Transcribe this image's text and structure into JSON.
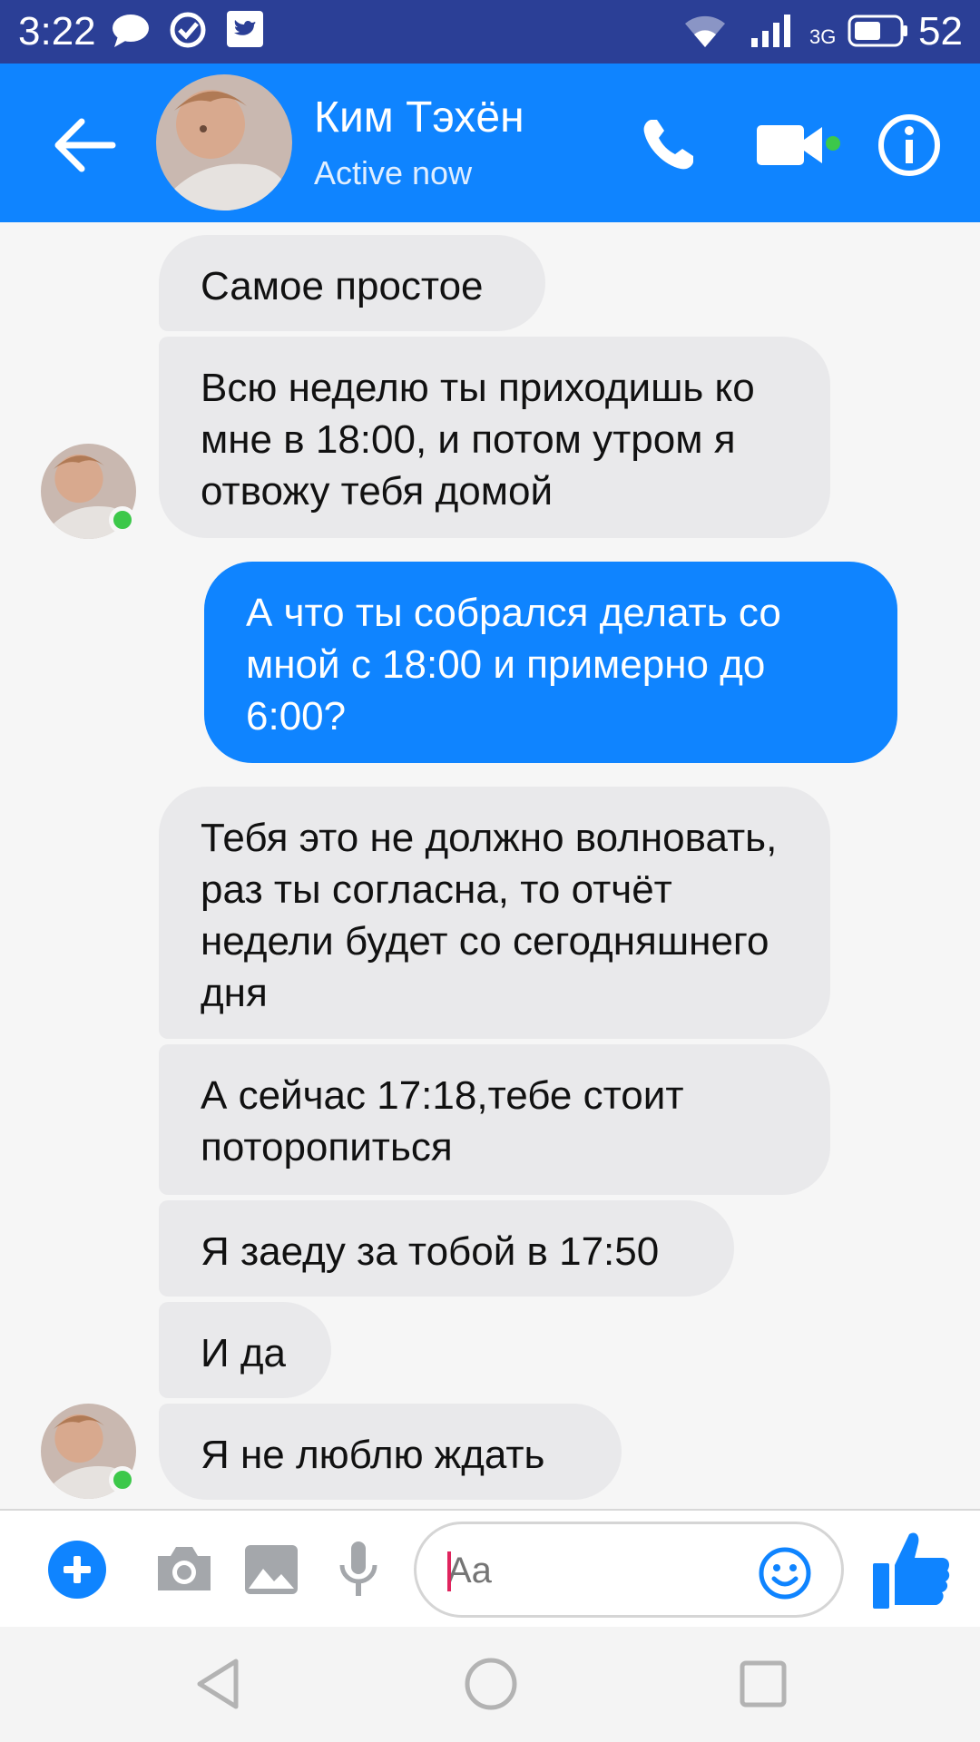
{
  "status_bar": {
    "time": "3:22",
    "network": "3G",
    "battery": "52"
  },
  "header": {
    "contact_name": "Ким Тэхён",
    "contact_status": "Active now",
    "colors": {
      "header_bg": "#0f84ff",
      "status_bar_bg": "#2b3f96",
      "online": "#3cc84a"
    }
  },
  "messages": [
    {
      "direction": "incoming",
      "text": "Самое простое"
    },
    {
      "direction": "incoming",
      "text": "Всю неделю ты приходишь ко мне в 18:00, и потом утром я отвожу тебя домой"
    },
    {
      "direction": "outgoing",
      "text": "А что ты собрался делать со мной с 18:00 и примерно до 6:00?"
    },
    {
      "direction": "incoming",
      "text": "Тебя это не должно волновать, раз ты согласна, то отчёт недели будет со сегодняшнего дня"
    },
    {
      "direction": "incoming",
      "text": "А сейчас 17:18,тебе стоит поторопиться"
    },
    {
      "direction": "incoming",
      "text": "Я заеду за тобой в 17:50"
    },
    {
      "direction": "incoming",
      "text": "И да"
    },
    {
      "direction": "incoming",
      "text": "Я не люблю ждать"
    }
  ],
  "composer": {
    "placeholder": "Aa",
    "icons": [
      "plus-icon",
      "camera-icon",
      "gallery-icon",
      "microphone-icon",
      "emoji-icon",
      "thumbs-up-icon"
    ]
  },
  "navbar": {
    "icons": [
      "back-triangle-icon",
      "home-circle-icon",
      "recents-square-icon"
    ]
  }
}
